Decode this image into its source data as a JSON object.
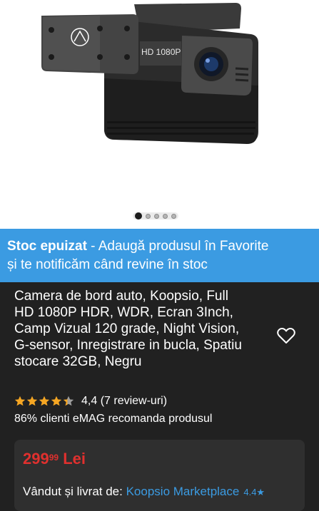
{
  "gallery": {
    "image_alt": "Camera de bord auto Koopsio",
    "image_text": "HD 1080P",
    "slides": 5,
    "active_slide": 1
  },
  "banner": {
    "label_bold": "Stoc epuizat",
    "text_line1": " - Adaugă produsul în Favorite",
    "text_line2": "și te notificăm când revine în stoc"
  },
  "product": {
    "title_lines": [
      "Camera de bord auto, Koopsio, Full",
      "HD 1080P HDR, WDR, Ecran 3Inch,",
      "Camp Vizual 120 grade, Night Vision,",
      "G-sensor, Inregistrare in bucla, Spatiu",
      "stocare 32GB, Negru"
    ],
    "favorite_icon": "heart-outline-icon"
  },
  "rating": {
    "value": 4.4,
    "max": 5,
    "text": "4,4 (7 review-uri)",
    "star_color": "#f5a623",
    "star_empty_color": "#9e9e9e"
  },
  "recommend": {
    "text": "86% clienti eMAG recomanda produsul"
  },
  "price": {
    "integer": "299",
    "decimals": "99",
    "currency": "Lei",
    "color": "#e0302e"
  },
  "seller": {
    "label": "Vândut și livrat de:",
    "name": "Koopsio Marketplace",
    "rating": "4.4★"
  },
  "colors": {
    "background": "#212121",
    "banner": "#3b9be2",
    "link": "#3b9be2"
  }
}
